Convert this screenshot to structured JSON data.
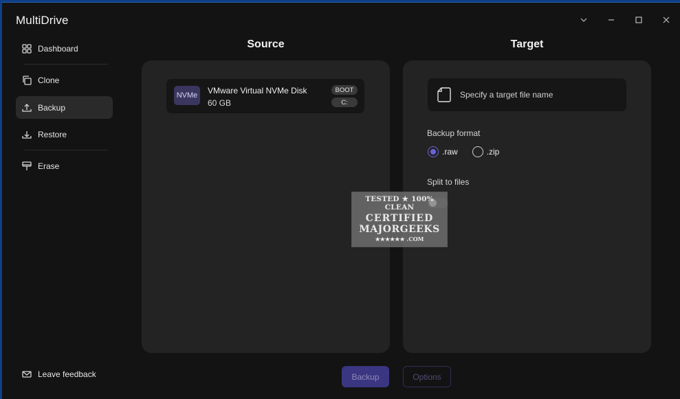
{
  "window": {
    "title": "MultiDrive",
    "controls": [
      "chevron-down",
      "minimize",
      "maximize",
      "close"
    ]
  },
  "sidebar": {
    "items": [
      {
        "label": "Dashboard",
        "icon": "dashboard-grid-icon",
        "active": false
      },
      {
        "label": "Clone",
        "icon": "clone-icon",
        "active": false
      },
      {
        "label": "Backup",
        "icon": "upload-icon",
        "active": true
      },
      {
        "label": "Restore",
        "icon": "download-icon",
        "active": false
      },
      {
        "label": "Erase",
        "icon": "eraser-icon",
        "active": false
      }
    ],
    "feedback_label": "Leave feedback"
  },
  "source": {
    "title": "Source",
    "disk": {
      "badge": "NVMe",
      "name": "VMware Virtual NVMe Disk",
      "size": "60 GB",
      "tags": [
        "BOOT",
        "C:"
      ]
    }
  },
  "target": {
    "title": "Target",
    "file_placeholder": "Specify a target file name",
    "backup_format_label": "Backup format",
    "formats": [
      {
        "label": ".raw",
        "selected": true
      },
      {
        "label": ".zip",
        "selected": false
      }
    ],
    "split_label": "Split to files",
    "split_enabled": false
  },
  "watermark": {
    "line1": "TESTED ★ 100% CLEAN",
    "line2": "CERTIFIED",
    "line3": "MAJORGEEKS",
    "line4": "★★★★★★ .COM"
  },
  "actions": {
    "backup_label": "Backup",
    "options_label": "Options"
  },
  "colors": {
    "accent": "#6c63d8",
    "backup_button": "#3b3681",
    "panel_bg": "#232323",
    "window_bg": "#131313"
  }
}
